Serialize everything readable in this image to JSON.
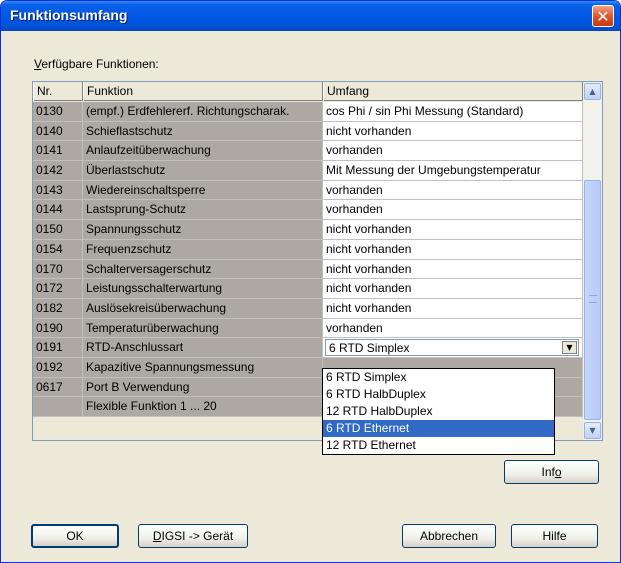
{
  "window": {
    "title": "Funktionsumfang",
    "close": "✕"
  },
  "group_label": {
    "first": "V",
    "rest": "erfügbare Funktionen:"
  },
  "table": {
    "headers": [
      "Nr.",
      "Funktion",
      "Umfang"
    ],
    "rows": [
      [
        "0130",
        "(empf.) Erdfehlererf. Richtungscharak.",
        "cos Phi / sin Phi Messung (Standard)"
      ],
      [
        "0140",
        "Schieflastschutz",
        "nicht vorhanden"
      ],
      [
        "0141",
        "Anlaufzeitüberwachung",
        "vorhanden"
      ],
      [
        "0142",
        "Überlastschutz",
        "Mit Messung der Umgebungstemperatur"
      ],
      [
        "0143",
        "Wiedereinschaltsperre",
        "vorhanden"
      ],
      [
        "0144",
        "Lastsprung-Schutz",
        "vorhanden"
      ],
      [
        "0150",
        "Spannungsschutz",
        "nicht vorhanden"
      ],
      [
        "0154",
        "Frequenzschutz",
        "nicht vorhanden"
      ],
      [
        "0170",
        "Schalterversagerschutz",
        "nicht vorhanden"
      ],
      [
        "0172",
        "Leistungsschalterwartung",
        "nicht vorhanden"
      ],
      [
        "0182",
        "Auslösekreisüberwachung",
        "nicht vorhanden"
      ],
      [
        "0190",
        "Temperaturüberwachung",
        "vorhanden"
      ],
      [
        "0191",
        "RTD-Anschlussart",
        "6 RTD Simplex"
      ],
      [
        "0192",
        "Kapazitive Spannungsmessung",
        ""
      ],
      [
        "0617",
        "Port B Verwendung",
        ""
      ],
      [
        "",
        "Flexible Funktion 1 ... 20",
        ""
      ]
    ]
  },
  "dropdown": {
    "options": [
      "6 RTD Simplex",
      "6 RTD HalbDuplex",
      "12 RTD HalbDuplex",
      "6 RTD Ethernet",
      "12 RTD Ethernet"
    ],
    "highlighted_index": 3
  },
  "scrollbar": {
    "up": "▲",
    "down": "▼",
    "combo_arrow": "▼"
  },
  "buttons": {
    "info": {
      "before": "Inf",
      "under": "o"
    },
    "ok": "OK",
    "digsi": {
      "under": "D",
      "rest": "IGSI -> Gerät"
    },
    "cancel": "Abbrechen",
    "help": "Hilfe"
  },
  "colors": {
    "title_blue": "#0058e6",
    "selection": "#316ac5",
    "gray_cell": "#ada9a2"
  }
}
